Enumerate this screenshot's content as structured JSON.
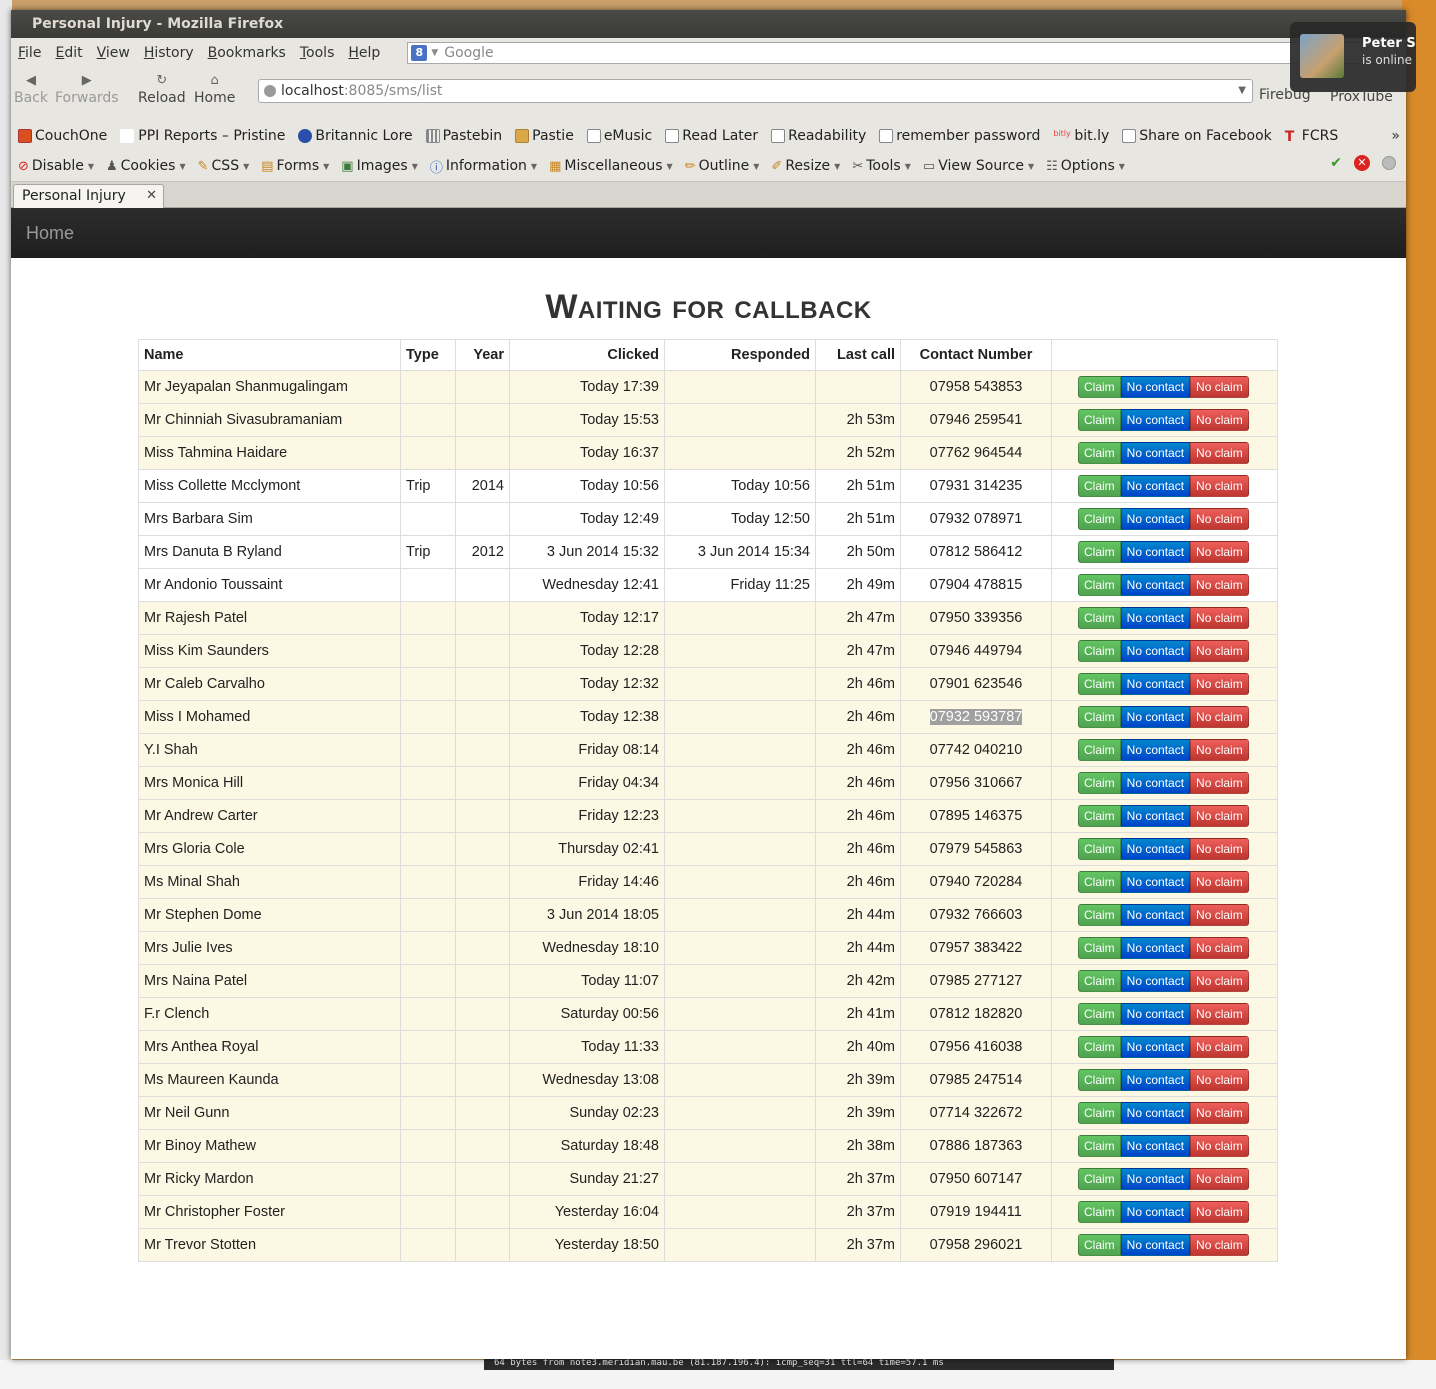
{
  "window": {
    "title": "Personal Injury - Mozilla Firefox"
  },
  "menu": [
    "File",
    "Edit",
    "View",
    "History",
    "Bookmarks",
    "Tools",
    "Help"
  ],
  "search": {
    "placeholder": "Google",
    "engine_glyph": "8"
  },
  "nav": {
    "back": "Back",
    "forwards": "Forwards",
    "reload": "Reload",
    "home": "Home"
  },
  "url": {
    "host": "localhost",
    "rest": ":8085/sms/list"
  },
  "extras": {
    "firebug": "Firebug",
    "proxtube": "ProxTube"
  },
  "chat": {
    "name": "Peter S",
    "status": "is online"
  },
  "bookmarks": [
    {
      "label": "CouchOne",
      "icon": "couch-icon"
    },
    {
      "label": "PPI Reports – Pristine",
      "icon": "page-icon"
    },
    {
      "label": "Britannic Lore",
      "icon": "cube-icon"
    },
    {
      "label": "Pastebin",
      "icon": "grid-icon"
    },
    {
      "label": "Pastie",
      "icon": "paste-icon"
    },
    {
      "label": "eMusic",
      "icon": "bookmarklet-icon"
    },
    {
      "label": "Read Later",
      "icon": "bookmarklet-icon"
    },
    {
      "label": "Readability",
      "icon": "bookmarklet-icon"
    },
    {
      "label": "remember password",
      "icon": "bookmarklet-icon"
    },
    {
      "label": "bit.ly",
      "icon": "bitly-icon"
    },
    {
      "label": "Share on Facebook",
      "icon": "bookmarklet-icon"
    },
    {
      "label": "FCRS",
      "icon": "telegraph-icon"
    }
  ],
  "devtools": [
    {
      "label": "Disable",
      "icon": "disable-icon"
    },
    {
      "label": "Cookies",
      "icon": "cookie-icon"
    },
    {
      "label": "CSS",
      "icon": "css-icon"
    },
    {
      "label": "Forms",
      "icon": "forms-icon"
    },
    {
      "label": "Images",
      "icon": "images-icon"
    },
    {
      "label": "Information",
      "icon": "info-icon"
    },
    {
      "label": "Miscellaneous",
      "icon": "misc-icon"
    },
    {
      "label": "Outline",
      "icon": "outline-icon"
    },
    {
      "label": "Resize",
      "icon": "resize-icon"
    },
    {
      "label": "Tools",
      "icon": "tools-icon"
    },
    {
      "label": "View Source",
      "icon": "source-icon"
    },
    {
      "label": "Options",
      "icon": "options-icon"
    }
  ],
  "tab": {
    "label": "Personal Injury"
  },
  "app": {
    "nav_home": "Home",
    "heading": "Waiting for callback"
  },
  "buttons": {
    "claim": "Claim",
    "no_contact": "No contact",
    "no_claim": "No claim"
  },
  "table": {
    "headers": [
      "Name",
      "Type",
      "Year",
      "Clicked",
      "Responded",
      "Last call",
      "Contact Number",
      ""
    ],
    "rows": [
      {
        "name": "Mr Jeyapalan Shanmugalingam",
        "type": "",
        "year": "",
        "clicked": "Today 17:39",
        "responded": "",
        "last_call": "",
        "contact": "07958 543853",
        "style": "warn"
      },
      {
        "name": "Mr Chinniah Sivasubramaniam",
        "type": "",
        "year": "",
        "clicked": "Today 15:53",
        "responded": "",
        "last_call": "2h 53m",
        "contact": "07946 259541",
        "style": "warn"
      },
      {
        "name": "Miss Tahmina Haidare",
        "type": "",
        "year": "",
        "clicked": "Today 16:37",
        "responded": "",
        "last_call": "2h 52m",
        "contact": "07762 964544",
        "style": "warn"
      },
      {
        "name": "Miss Collette Mcclymont",
        "type": "Trip",
        "year": "2014",
        "clicked": "Today 10:56",
        "responded": "Today 10:56",
        "last_call": "2h 51m",
        "contact": "07931 314235",
        "style": "plain"
      },
      {
        "name": "Mrs Barbara Sim",
        "type": "",
        "year": "",
        "clicked": "Today 12:49",
        "responded": "Today 12:50",
        "last_call": "2h 51m",
        "contact": "07932 078971",
        "style": "plain"
      },
      {
        "name": "Mrs Danuta B Ryland",
        "type": "Trip",
        "year": "2012",
        "clicked": "3 Jun 2014 15:32",
        "responded": "3 Jun 2014 15:34",
        "last_call": "2h 50m",
        "contact": "07812 586412",
        "style": "plain"
      },
      {
        "name": "Mr Andonio Toussaint",
        "type": "",
        "year": "",
        "clicked": "Wednesday 12:41",
        "responded": "Friday 11:25",
        "last_call": "2h 49m",
        "contact": "07904 478815",
        "style": "plain"
      },
      {
        "name": "Mr Rajesh Patel",
        "type": "",
        "year": "",
        "clicked": "Today 12:17",
        "responded": "",
        "last_call": "2h 47m",
        "contact": "07950 339356",
        "style": "warn"
      },
      {
        "name": "Miss Kim Saunders",
        "type": "",
        "year": "",
        "clicked": "Today 12:28",
        "responded": "",
        "last_call": "2h 47m",
        "contact": "07946 449794",
        "style": "warn"
      },
      {
        "name": "Mr Caleb Carvalho",
        "type": "",
        "year": "",
        "clicked": "Today 12:32",
        "responded": "",
        "last_call": "2h 46m",
        "contact": "07901 623546",
        "style": "warn"
      },
      {
        "name": "Miss I Mohamed",
        "type": "",
        "year": "",
        "clicked": "Today 12:38",
        "responded": "",
        "last_call": "2h 46m",
        "contact": "07932 593787",
        "style": "warn",
        "selected": true
      },
      {
        "name": "Y.I Shah",
        "type": "",
        "year": "",
        "clicked": "Friday 08:14",
        "responded": "",
        "last_call": "2h 46m",
        "contact": "07742 040210",
        "style": "warn"
      },
      {
        "name": "Mrs Monica Hill",
        "type": "",
        "year": "",
        "clicked": "Friday 04:34",
        "responded": "",
        "last_call": "2h 46m",
        "contact": "07956 310667",
        "style": "warn"
      },
      {
        "name": "Mr Andrew Carter",
        "type": "",
        "year": "",
        "clicked": "Friday 12:23",
        "responded": "",
        "last_call": "2h 46m",
        "contact": "07895 146375",
        "style": "warn"
      },
      {
        "name": "Mrs Gloria Cole",
        "type": "",
        "year": "",
        "clicked": "Thursday 02:41",
        "responded": "",
        "last_call": "2h 46m",
        "contact": "07979 545863",
        "style": "warn"
      },
      {
        "name": "Ms Minal Shah",
        "type": "",
        "year": "",
        "clicked": "Friday 14:46",
        "responded": "",
        "last_call": "2h 46m",
        "contact": "07940 720284",
        "style": "warn"
      },
      {
        "name": "Mr Stephen Dome",
        "type": "",
        "year": "",
        "clicked": "3 Jun 2014 18:05",
        "responded": "",
        "last_call": "2h 44m",
        "contact": "07932 766603",
        "style": "warn"
      },
      {
        "name": "Mrs Julie Ives",
        "type": "",
        "year": "",
        "clicked": "Wednesday 18:10",
        "responded": "",
        "last_call": "2h 44m",
        "contact": "07957 383422",
        "style": "warn"
      },
      {
        "name": "Mrs Naina Patel",
        "type": "",
        "year": "",
        "clicked": "Today 11:07",
        "responded": "",
        "last_call": "2h 42m",
        "contact": "07985 277127",
        "style": "warn"
      },
      {
        "name": "F.r Clench",
        "type": "",
        "year": "",
        "clicked": "Saturday 00:56",
        "responded": "",
        "last_call": "2h 41m",
        "contact": "07812 182820",
        "style": "warn"
      },
      {
        "name": "Mrs Anthea Royal",
        "type": "",
        "year": "",
        "clicked": "Today 11:33",
        "responded": "",
        "last_call": "2h 40m",
        "contact": "07956 416038",
        "style": "warn"
      },
      {
        "name": "Ms Maureen Kaunda",
        "type": "",
        "year": "",
        "clicked": "Wednesday 13:08",
        "responded": "",
        "last_call": "2h 39m",
        "contact": "07985 247514",
        "style": "warn"
      },
      {
        "name": "Mr Neil Gunn",
        "type": "",
        "year": "",
        "clicked": "Sunday 02:23",
        "responded": "",
        "last_call": "2h 39m",
        "contact": "07714 322672",
        "style": "warn"
      },
      {
        "name": "Mr Binoy Mathew",
        "type": "",
        "year": "",
        "clicked": "Saturday 18:48",
        "responded": "",
        "last_call": "2h 38m",
        "contact": "07886 187363",
        "style": "warn"
      },
      {
        "name": "Mr Ricky Mardon",
        "type": "",
        "year": "",
        "clicked": "Sunday 21:27",
        "responded": "",
        "last_call": "2h 37m",
        "contact": "07950 607147",
        "style": "warn"
      },
      {
        "name": "Mr Christopher Foster",
        "type": "",
        "year": "",
        "clicked": "Yesterday 16:04",
        "responded": "",
        "last_call": "2h 37m",
        "contact": "07919 194411",
        "style": "warn"
      },
      {
        "name": "Mr Trevor Stotten",
        "type": "",
        "year": "",
        "clicked": "Yesterday 18:50",
        "responded": "",
        "last_call": "2h 37m",
        "contact": "07958 296021",
        "style": "warn"
      }
    ]
  },
  "terminal": {
    "text": "64 bytes from note3.meridian.mau.be (81.187.196.4): icmp_seq=31 ttl=64 time=57.1 ms"
  }
}
